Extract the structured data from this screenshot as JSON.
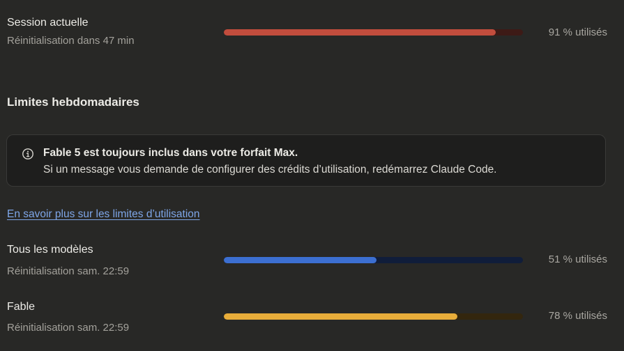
{
  "session": {
    "title": "Session actuelle",
    "reset": "Réinitialisation dans 47 min",
    "usage_fraction": 0.91,
    "usage_label": "91 % utilisés",
    "fill_color": "#c24d3d",
    "track_color": "#3d1a16"
  },
  "weekly": {
    "heading": "Limites hebdomadaires",
    "notice": {
      "icon": "info-icon",
      "title": "Fable 5 est toujours inclus dans votre forfait Max.",
      "body": "Si un message vous demande de configurer des crédits d’utilisation, redémarrez Claude Code."
    },
    "learn_more_link": "En savoir plus sur les limites d’utilisation",
    "limits": [
      {
        "title": "Tous les modèles",
        "reset": "Réinitialisation sam. 22:59",
        "usage_fraction": 0.51,
        "usage_label": "51 % utilisés",
        "fill_color": "#3c6fd1",
        "track_color": "#101d3a"
      },
      {
        "title": "Fable",
        "reset": "Réinitialisation sam. 22:59",
        "usage_fraction": 0.78,
        "usage_label": "78 % utilisés",
        "fill_color": "#e8ad3a",
        "track_color": "#33260e"
      }
    ]
  }
}
